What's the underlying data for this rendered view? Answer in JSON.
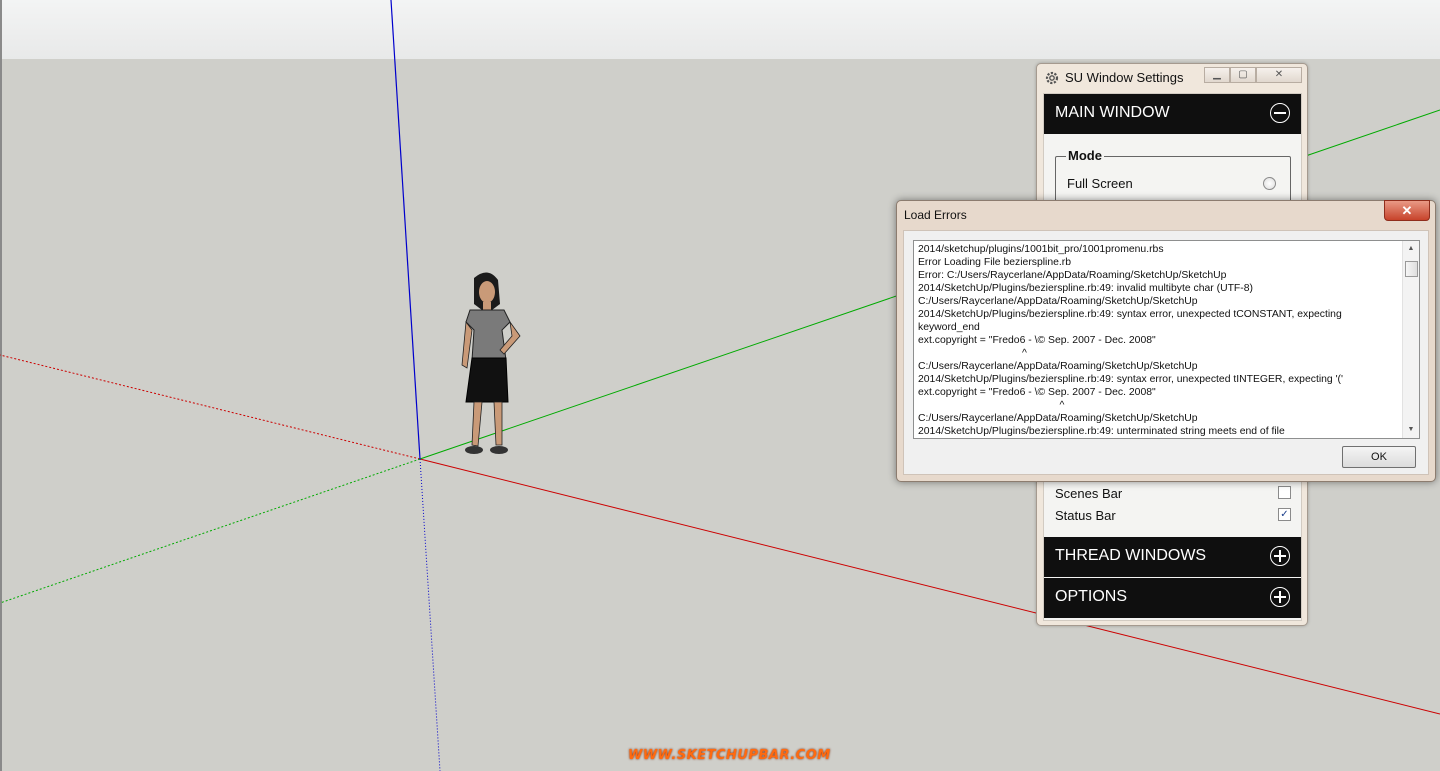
{
  "settings_panel": {
    "title": "SU Window Settings",
    "main_window": {
      "heading": "MAIN WINDOW",
      "expanded": true,
      "mode": {
        "legend": "Mode",
        "options": [
          {
            "label": "Full Screen",
            "selected": false
          }
        ]
      },
      "toggles": [
        {
          "label": "Scenes Bar",
          "checked": false
        },
        {
          "label": "Status Bar",
          "checked": true
        }
      ]
    },
    "thread_windows": {
      "heading": "THREAD WINDOWS",
      "expanded": false
    },
    "options": {
      "heading": "OPTIONS",
      "expanded": false
    }
  },
  "load_errors": {
    "title": "Load Errors",
    "close_label": "✕",
    "message": "2014/sketchup/plugins/1001bit_pro/1001promenu.rbs\nError Loading File bezierspline.rb\nError: C:/Users/Raycerlane/AppData/Roaming/SketchUp/SketchUp\n2014/SketchUp/Plugins/bezierspline.rb:49: invalid multibyte char (UTF-8)\nC:/Users/Raycerlane/AppData/Roaming/SketchUp/SketchUp\n2014/SketchUp/Plugins/bezierspline.rb:49: syntax error, unexpected tCONSTANT, expecting\nkeyword_end\next.copyright = \"Fredo6 - \\© Sep. 2007 - Dec. 2008\"\n                                    ^\nC:/Users/Raycerlane/AppData/Roaming/SketchUp/SketchUp\n2014/SketchUp/Plugins/bezierspline.rb:49: syntax error, unexpected tINTEGER, expecting '('\next.copyright = \"Fredo6 - \\© Sep. 2007 - Dec. 2008\"\n                                                 ^\nC:/Users/Raycerlane/AppData/Roaming/SketchUp/SketchUp\n2014/SketchUp/Plugins/bezierspline.rb:49: unterminated string meets end of file",
    "ok_label": "OK"
  },
  "watermark": "WWW.SKETCHUPBAR.COM",
  "icons": {
    "settings": "gear-icon",
    "minimize": "minimize-icon",
    "maximize": "maximize-icon",
    "close": "close-icon",
    "collapse": "minus-circle-icon",
    "expand": "plus-circle-icon"
  },
  "colors": {
    "sky": "#eeefef",
    "ground": "#cfcfca",
    "red_axis": "#cc0000",
    "green_axis": "#00aa00",
    "blue_axis": "#0000cc",
    "section_header": "#0f0f0f",
    "watermark": "#ff6a10"
  }
}
